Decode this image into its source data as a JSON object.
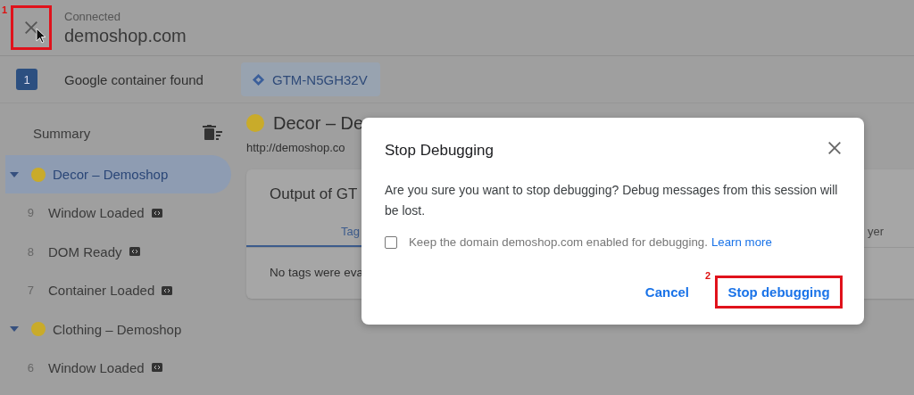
{
  "header": {
    "status": "Connected",
    "domain": "demoshop.com",
    "close_callout": "1",
    "close_highlighted": true
  },
  "container_bar": {
    "count": "1",
    "label": "Google container found",
    "container_id": "GTM-N5GH32V"
  },
  "sidebar": {
    "title": "Summary",
    "groups": [
      {
        "label": "Decor – Demoshop",
        "expanded": true,
        "selected": true,
        "children": [
          {
            "number": "9",
            "label": "Window Loaded"
          },
          {
            "number": "8",
            "label": "DOM Ready"
          },
          {
            "number": "7",
            "label": "Container Loaded"
          }
        ]
      },
      {
        "label": "Clothing – Demoshop",
        "expanded": true,
        "selected": false,
        "children": [
          {
            "number": "6",
            "label": "Window Loaded"
          }
        ]
      }
    ]
  },
  "main": {
    "title": "Decor – De",
    "url": "http://demoshop.co",
    "card_title": "Output of GT",
    "tabs": [
      {
        "label": "Tag",
        "selected": true
      },
      {
        "label": "yer",
        "selected": false
      }
    ],
    "empty_text": "No tags were eva"
  },
  "dialog": {
    "title": "Stop Debugging",
    "message": "Are you sure you want to stop debugging? Debug messages from this session will be lost.",
    "checkbox": {
      "label": "Keep the domain demoshop.com enabled for debugging.",
      "link": "Learn more",
      "checked": false
    },
    "buttons": [
      {
        "label": "Cancel",
        "highlighted": false
      },
      {
        "label": "Stop debugging",
        "highlighted": true,
        "callout": "2"
      }
    ]
  }
}
